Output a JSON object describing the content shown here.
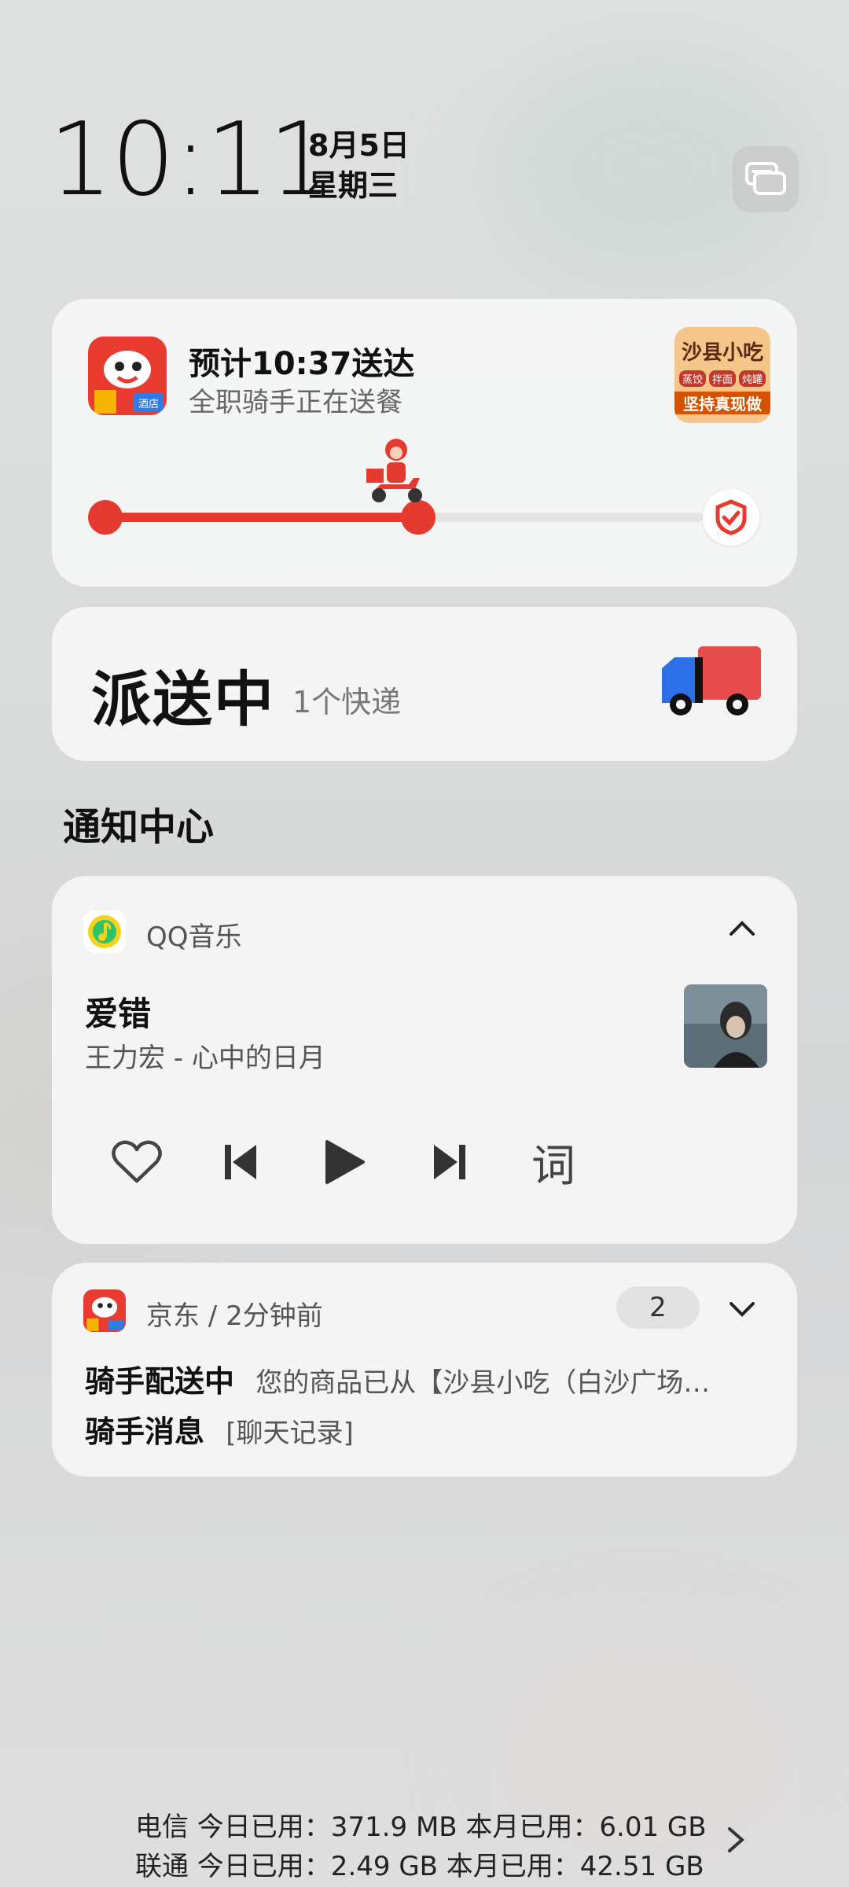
{
  "header": {
    "time": "10:11",
    "date": "8月5日",
    "weekday": "星期三",
    "edit_icon": "card-edit-icon"
  },
  "delivery": {
    "app_icon": "meituan-hotel-icon",
    "title": "预计10:37送达",
    "subtitle": "全职骑手正在送餐",
    "shop_logo_line1": "沙县小吃",
    "shop_logo_tags": [
      "蒸饺",
      "拌面",
      "炖罐"
    ],
    "shop_logo_line2": "坚持真现做",
    "progress": 0.51,
    "colors": {
      "accent": "#e53a2f"
    }
  },
  "express": {
    "title": "派送中",
    "count": "1个快递",
    "icon": "delivery-truck-icon"
  },
  "notification_center": {
    "title": "通知中心"
  },
  "music": {
    "app_name": "QQ音乐",
    "song": "爱错",
    "artist_album": "王力宏 - 心中的日月",
    "lyrics_label": "词",
    "icons": [
      "heart-icon",
      "previous-icon",
      "play-icon",
      "next-icon"
    ]
  },
  "jd": {
    "app_meta": "京东 / 2分钟前",
    "count": "2",
    "line1_title": "骑手配送中",
    "line1_text": "您的商品已从【沙县小吃（白沙广场…",
    "line2_title": "骑手消息",
    "line2_text": "[聊天记录]"
  },
  "data_usage": {
    "line1": "电信 今日已用：371.9 MB  本月已用：6.01 GB",
    "line2": "联通 今日已用：2.49 GB  本月已用：42.51 GB"
  }
}
